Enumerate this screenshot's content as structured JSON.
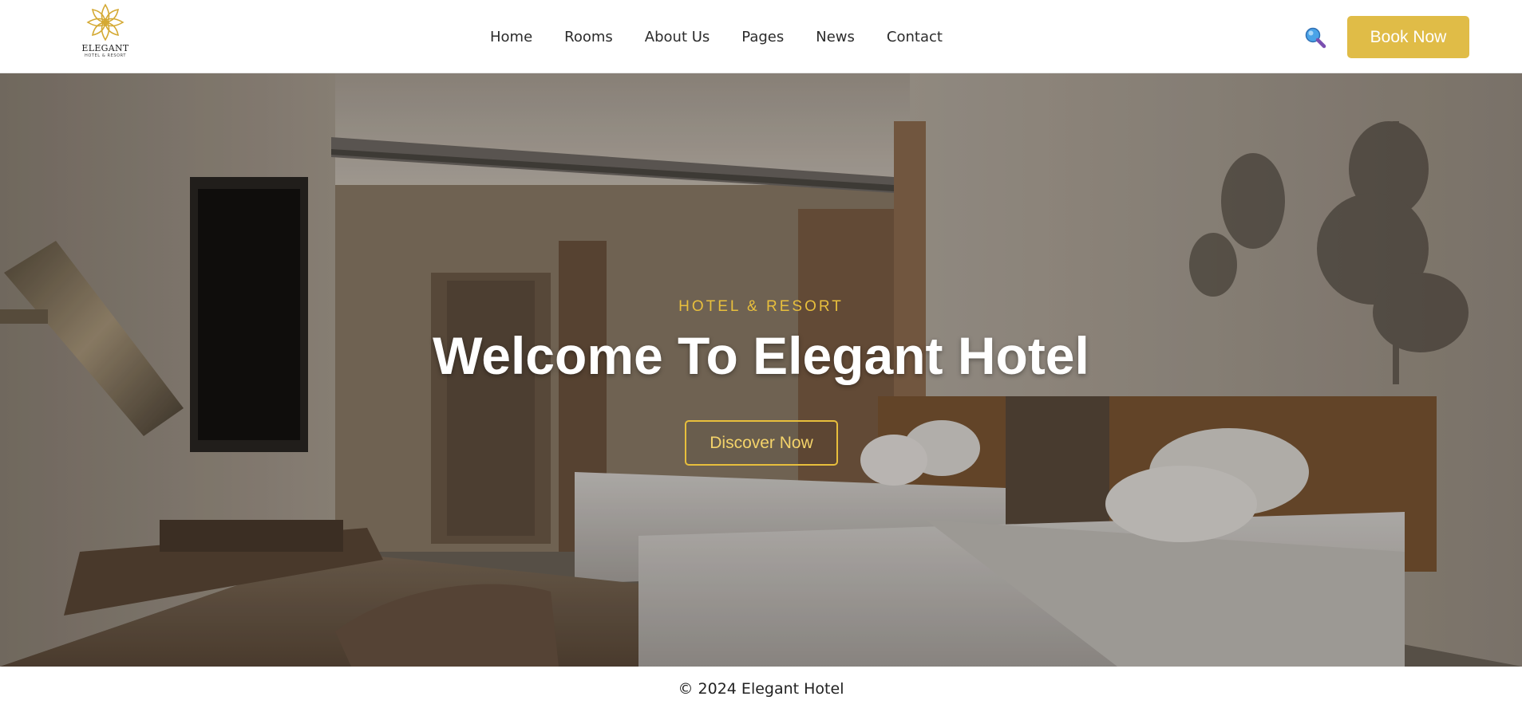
{
  "brand": {
    "name": "ELEGANT",
    "tagline": "HOTEL & RESORT",
    "logo_icon": "lotus-flower-icon",
    "accent_color": "#e0bc47"
  },
  "nav": {
    "items": [
      {
        "label": "Home"
      },
      {
        "label": "Rooms"
      },
      {
        "label": "About Us"
      },
      {
        "label": "Pages"
      },
      {
        "label": "News"
      },
      {
        "label": "Contact"
      }
    ],
    "search_icon": "magnifier-icon",
    "book_label": "Book Now"
  },
  "hero": {
    "eyebrow": "HOTEL & RESORT",
    "title": "Welcome To Elegant Hotel",
    "cta_label": "Discover Now",
    "background": "hotel-bedroom-photo"
  },
  "footer": {
    "copyright": "© 2024 Elegant Hotel"
  }
}
